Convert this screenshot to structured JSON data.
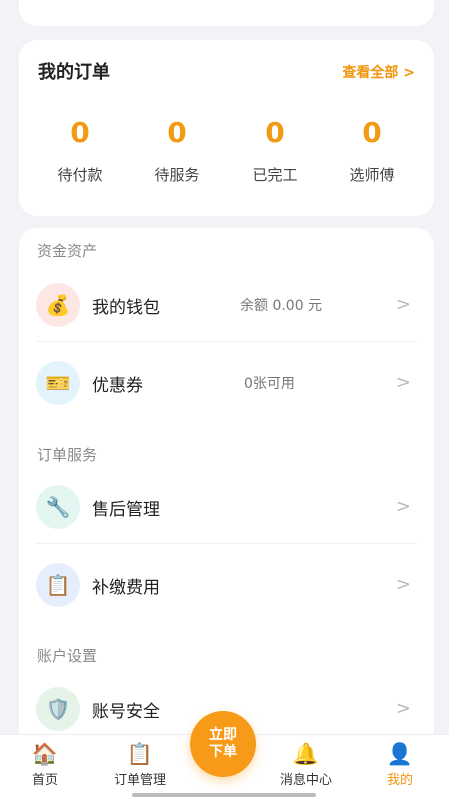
{
  "orders": {
    "title": "我的订单",
    "view_all": "查看全部 >",
    "stats": [
      {
        "value": "0",
        "label": "待付款"
      },
      {
        "value": "0",
        "label": "待服务"
      },
      {
        "value": "0",
        "label": "已完工"
      },
      {
        "value": "0",
        "label": "选师傅"
      }
    ]
  },
  "sections": {
    "assets": {
      "title": "资金资产",
      "items": [
        {
          "label": "我的钱包",
          "value": "余额 0.00 元",
          "icon": "money-bag-icon"
        },
        {
          "label": "优惠券",
          "value": "0张可用",
          "icon": "ticket-icon"
        }
      ]
    },
    "order_service": {
      "title": "订单服务",
      "items": [
        {
          "label": "售后管理",
          "icon": "wrench-icon"
        },
        {
          "label": "补缴费用",
          "icon": "clipboard-icon"
        }
      ]
    },
    "account": {
      "title": "账户设置",
      "items": [
        {
          "label": "账号安全",
          "icon": "shield-icon"
        }
      ]
    }
  },
  "arrow": ">",
  "order_button": {
    "line1": "立即",
    "line2": "下单"
  },
  "tabbar": [
    {
      "label": "首页",
      "icon": "home-icon"
    },
    {
      "label": "订单管理",
      "icon": "clipboard-icon"
    },
    {
      "label": "消息中心",
      "icon": "bell-icon"
    },
    {
      "label": "我的",
      "icon": "user-icon",
      "active": true
    }
  ],
  "colors": {
    "accent": "#f39a15",
    "background": "#f2f3f6"
  }
}
